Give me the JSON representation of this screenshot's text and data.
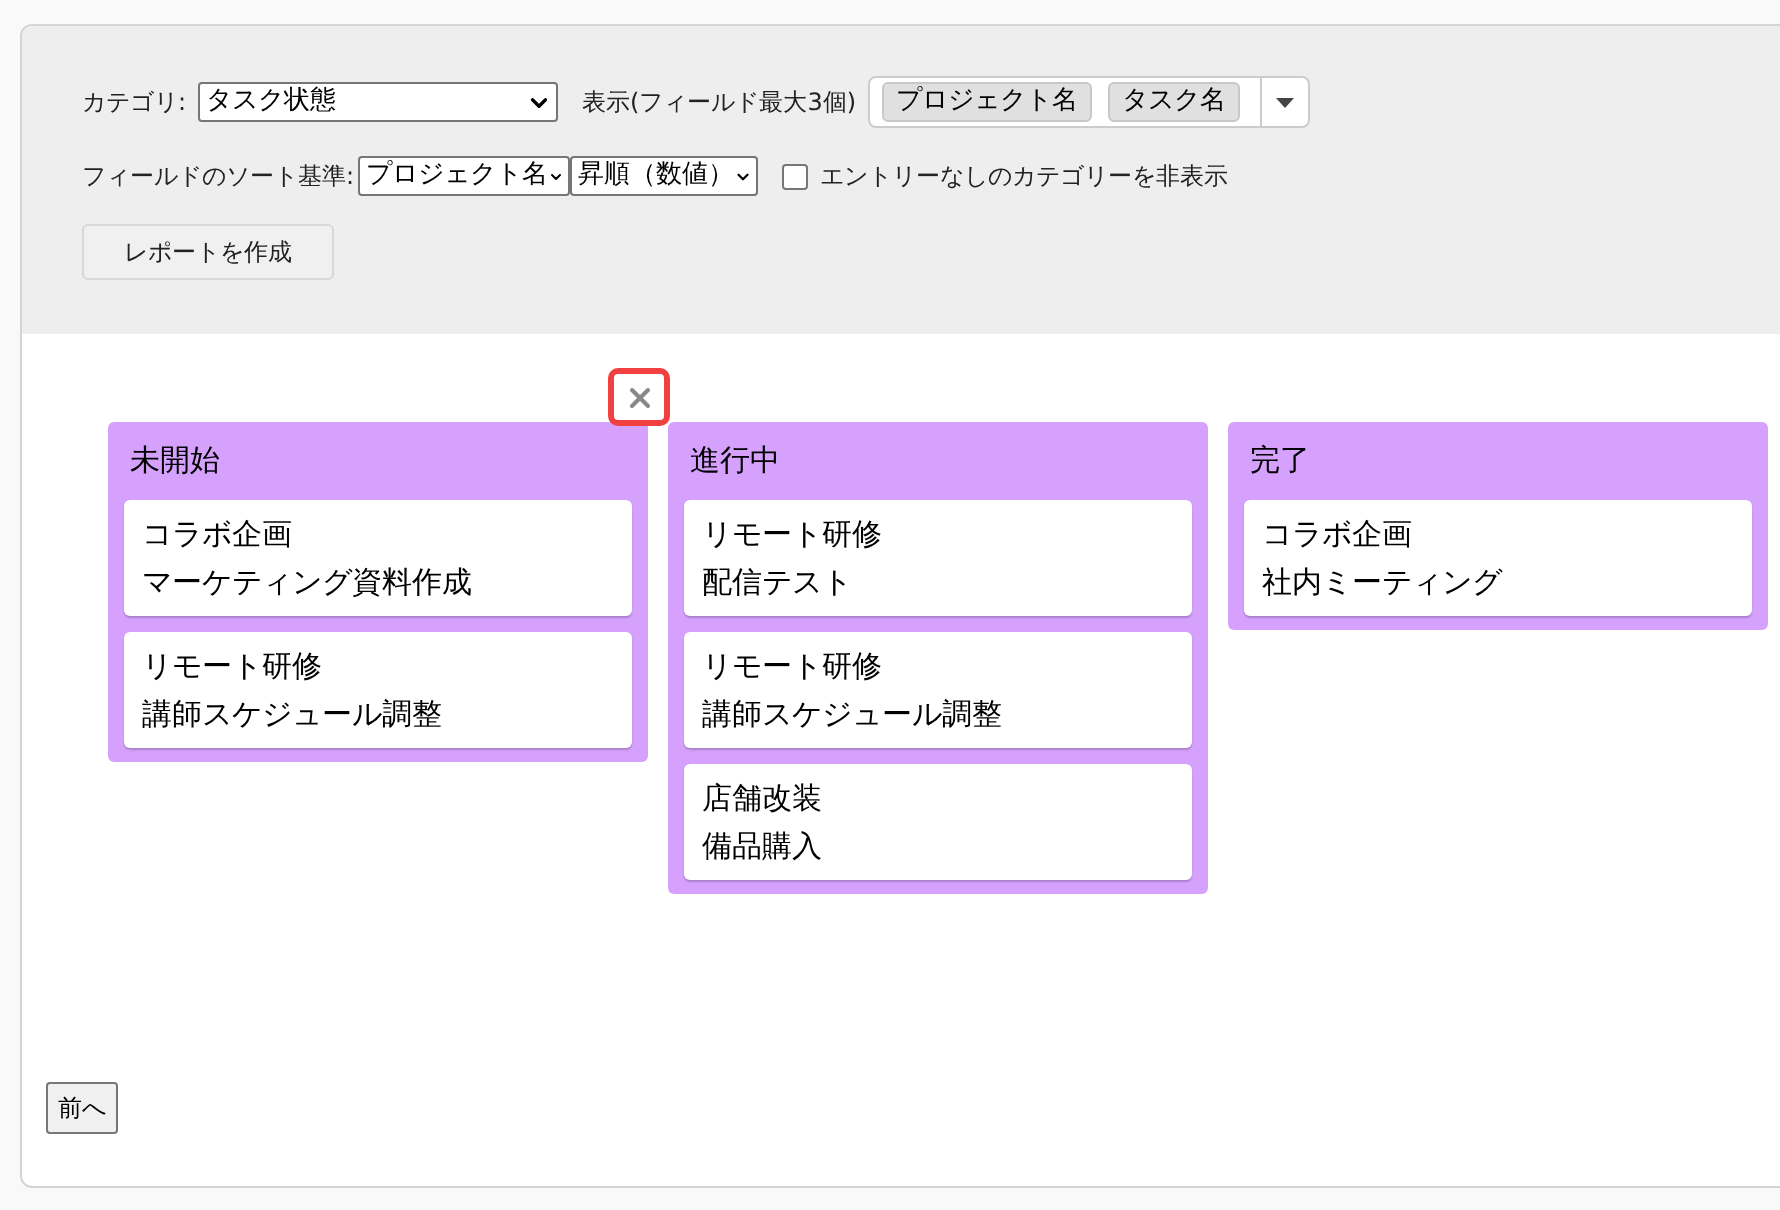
{
  "filters": {
    "category_label": "カテゴリ:",
    "category_value": "タスク状態",
    "display_label": "表示(フィールド最大3個)",
    "display_tags": [
      "プロジェクト名",
      "タスク名"
    ],
    "sort_label": "フィールドのソート基準:",
    "sort_field": "プロジェクト名",
    "sort_order": "昇順（数値）",
    "hide_empty": {
      "label": "エントリーなしのカテゴリーを非表示",
      "checked": false
    },
    "create_button": "レポートを作成"
  },
  "columns": [
    {
      "title": "未開始",
      "cards": [
        {
          "project": "コラボ企画",
          "task": "マーケティング資料作成"
        },
        {
          "project": "リモート研修",
          "task": "講師スケジュール調整"
        }
      ]
    },
    {
      "title": "進行中",
      "cards": [
        {
          "project": "リモート研修",
          "task": "配信テスト"
        },
        {
          "project": "リモート研修",
          "task": "講師スケジュール調整"
        },
        {
          "project": "店舗改装",
          "task": "備品購入"
        }
      ]
    },
    {
      "title": "完了",
      "cards": [
        {
          "project": "コラボ企画",
          "task": "社内ミーティング"
        }
      ]
    }
  ],
  "prev_button": "前へ"
}
